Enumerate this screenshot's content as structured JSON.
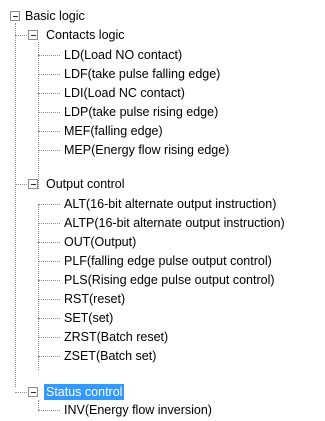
{
  "tree": {
    "root": {
      "label": "Basic logic",
      "groups": [
        {
          "label": "Contacts logic",
          "items": [
            "LD(Load NO contact)",
            "LDF(take pulse falling edge)",
            "LDI(Load NC contact)",
            "LDP(take pulse rising edge)",
            "MEF(falling edge)",
            "MEP(Energy flow rising edge)"
          ]
        },
        {
          "label": "Output control",
          "items": [
            "ALT(16-bit alternate output instruction)",
            "ALTP(16-bit alternate output instruction)",
            "OUT(Output)",
            "PLF(falling edge pulse output control)",
            "PLS(Rising edge pulse output control)",
            "RST(reset)",
            "SET(set)",
            "ZRST(Batch reset)",
            "ZSET(Batch set)"
          ]
        },
        {
          "label": "Status control",
          "selected": true,
          "items": [
            "INV(Energy flow inversion)"
          ]
        }
      ]
    }
  }
}
